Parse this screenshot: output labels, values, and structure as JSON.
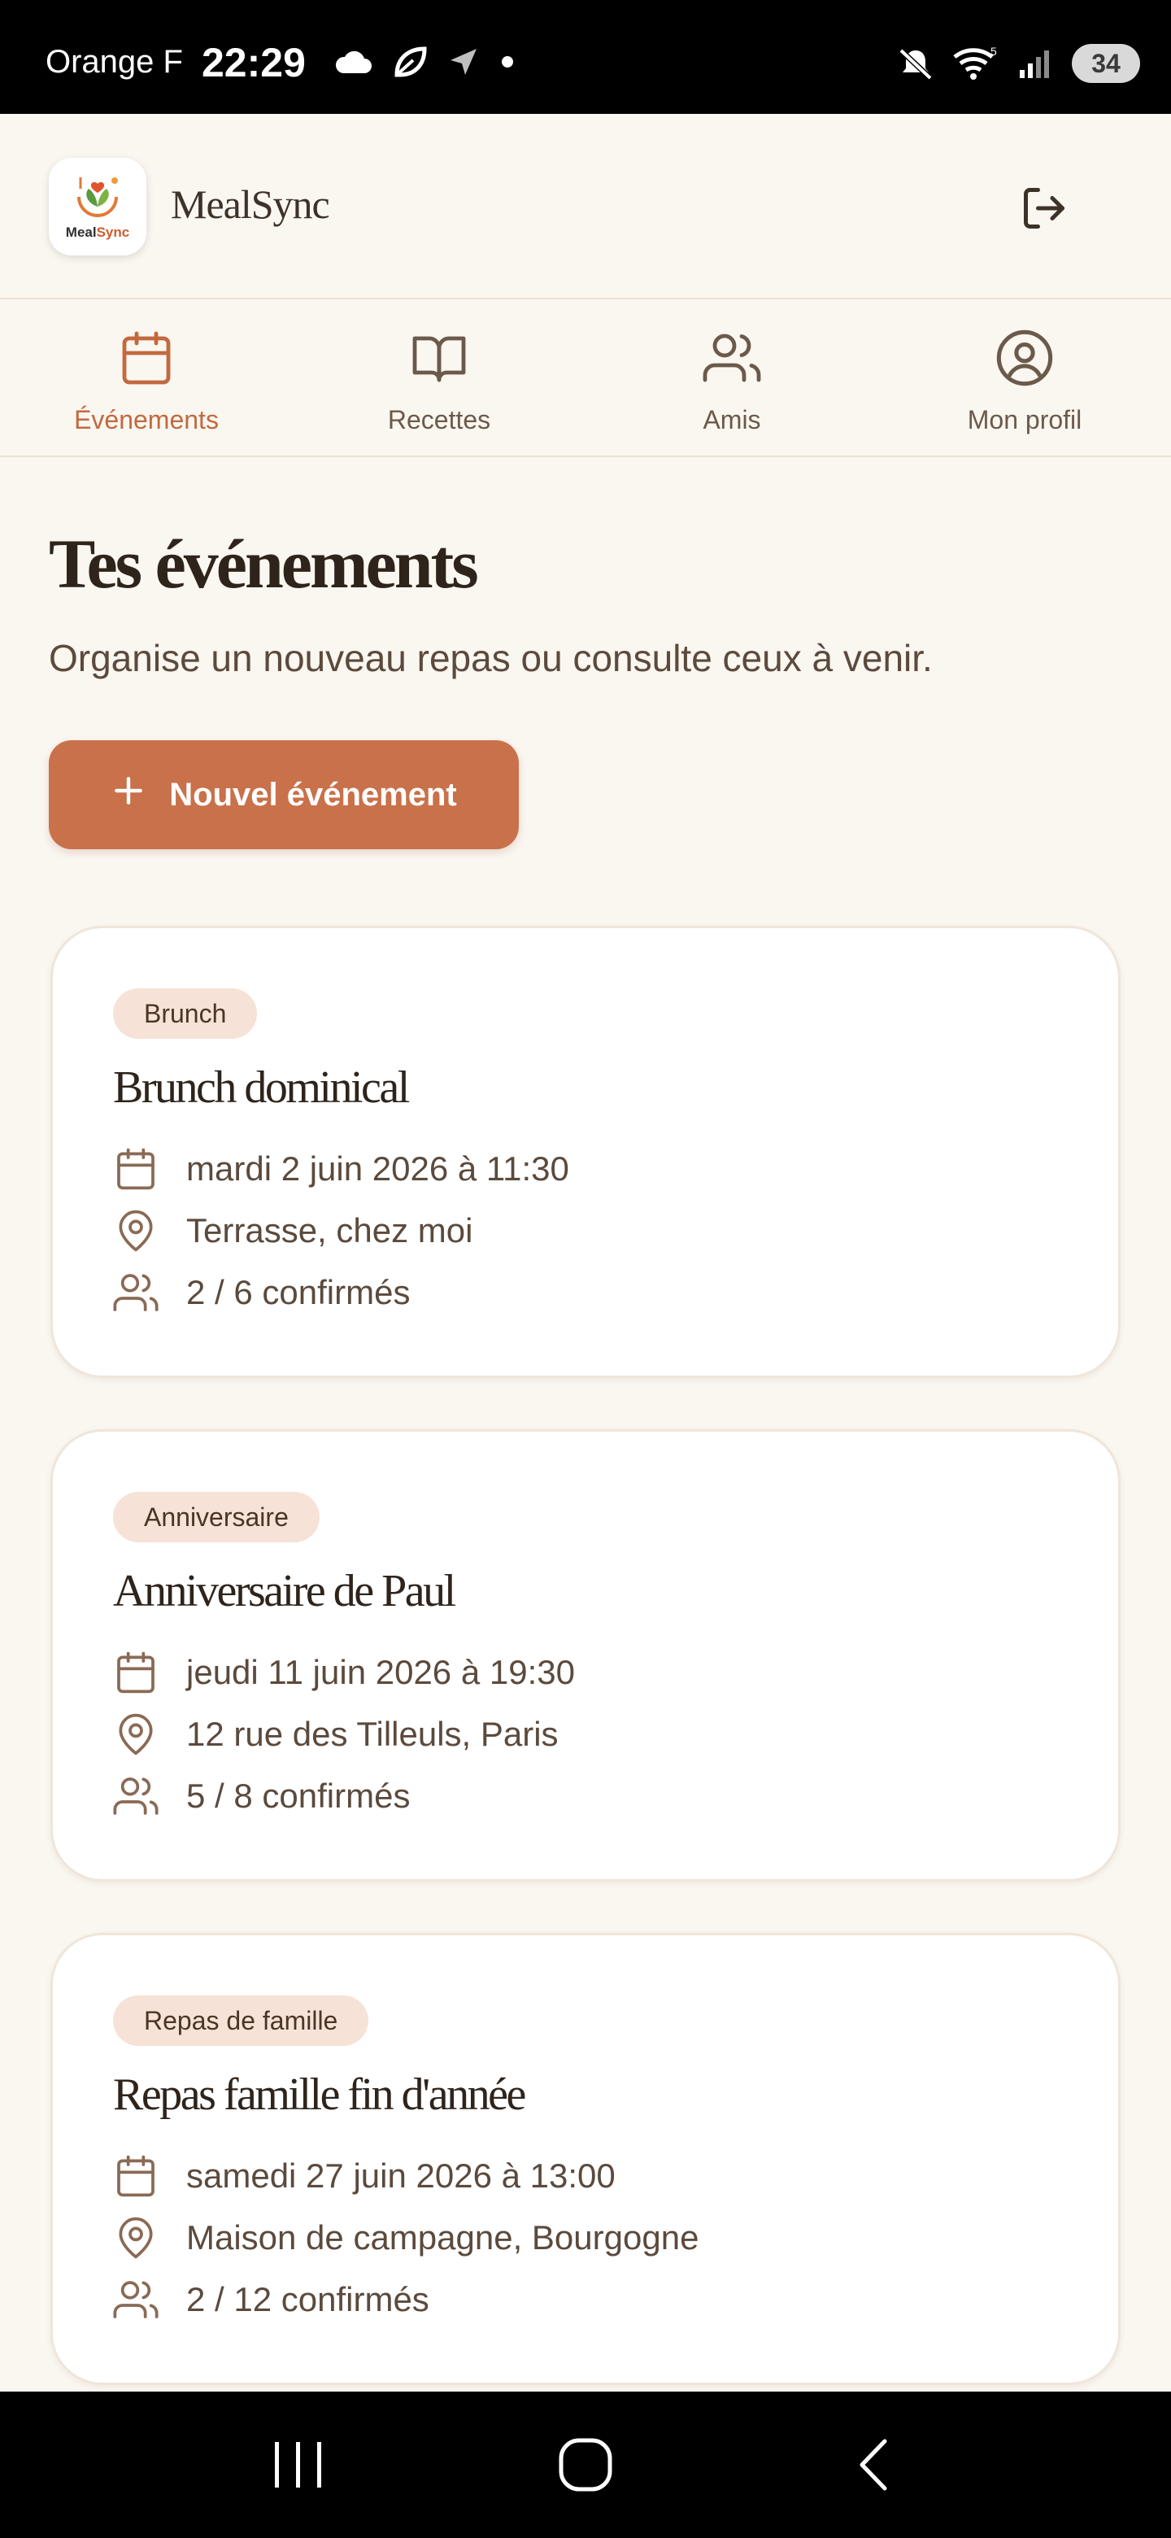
{
  "status_bar": {
    "carrier": "Orange F",
    "time": "22:29",
    "battery": "34",
    "icons": [
      "cloud-icon",
      "leaf-icon",
      "location-arrow-icon",
      "dot-icon",
      "mute-icon",
      "wifi-icon",
      "signal-icon"
    ]
  },
  "header": {
    "app_name": "MealSync",
    "logo_text_meal": "Meal",
    "logo_text_sync": "Sync",
    "logout_icon": "logout-icon"
  },
  "nav": {
    "items": [
      {
        "label": "Événements",
        "icon": "calendar-icon",
        "active": true
      },
      {
        "label": "Recettes",
        "icon": "book-icon",
        "active": false
      },
      {
        "label": "Amis",
        "icon": "users-icon",
        "active": false
      },
      {
        "label": "Mon profil",
        "icon": "user-circle-icon",
        "active": false
      }
    ]
  },
  "main": {
    "title": "Tes événements",
    "subtitle": "Organise un nouveau repas ou consulte ceux à venir.",
    "new_button_label": "Nouvel événement"
  },
  "events": [
    {
      "badge": "Brunch",
      "title": "Brunch dominical",
      "date": "mardi 2 juin 2026 à 11:30",
      "location": "Terrasse, chez moi",
      "confirmed": "2 / 6 confirmés"
    },
    {
      "badge": "Anniversaire",
      "title": "Anniversaire de Paul",
      "date": "jeudi 11 juin 2026 à 19:30",
      "location": "12 rue des Tilleuls, Paris",
      "confirmed": "5 / 8 confirmés"
    },
    {
      "badge": "Repas de famille",
      "title": "Repas famille fin d'année",
      "date": "samedi 27 juin 2026 à 13:00",
      "location": "Maison de campagne, Bourgogne",
      "confirmed": "2 / 12 confirmés"
    }
  ],
  "colors": {
    "accent": "#c9714a",
    "active_tab": "#c2693f",
    "background": "#faf6f0",
    "badge_bg": "#f7e2d7",
    "text": "#3d3229"
  }
}
